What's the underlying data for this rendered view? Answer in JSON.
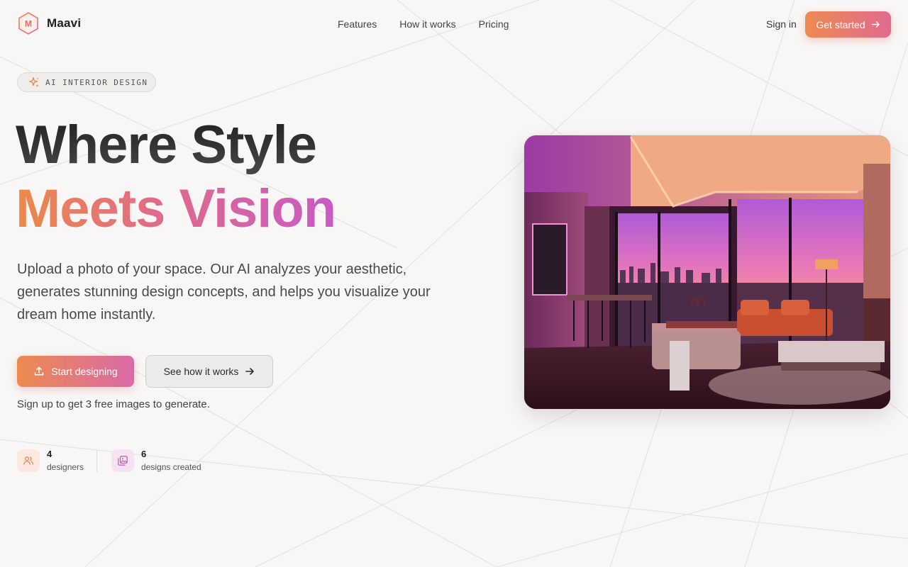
{
  "brand": {
    "name": "Maavi",
    "mark": "M"
  },
  "nav": {
    "items": [
      {
        "label": "Features"
      },
      {
        "label": "How it works"
      },
      {
        "label": "Pricing"
      }
    ],
    "sign_in": "Sign in",
    "get_started": "Get started"
  },
  "hero": {
    "badge": "AI INTERIOR DESIGN",
    "title_line1": "Where Style",
    "title_line2": "Meets Vision",
    "subtitle": "Upload a photo of your space. Our AI analyzes your aesthetic, generates stunning design concepts, and helps you visualize your dream home instantly.",
    "primary_cta": "Start designing",
    "secondary_cta": "See how it works",
    "note": "Sign up to get 3 free images to generate."
  },
  "stats": [
    {
      "value": "4",
      "label": "designers",
      "icon": "users-icon"
    },
    {
      "value": "6",
      "label": "designs created",
      "icon": "images-icon"
    }
  ],
  "colors": {
    "accent_orange": "#ee8a4e",
    "accent_pink": "#e06a8a",
    "accent_purple": "#c85ac6",
    "background": "#f8f7f5"
  }
}
